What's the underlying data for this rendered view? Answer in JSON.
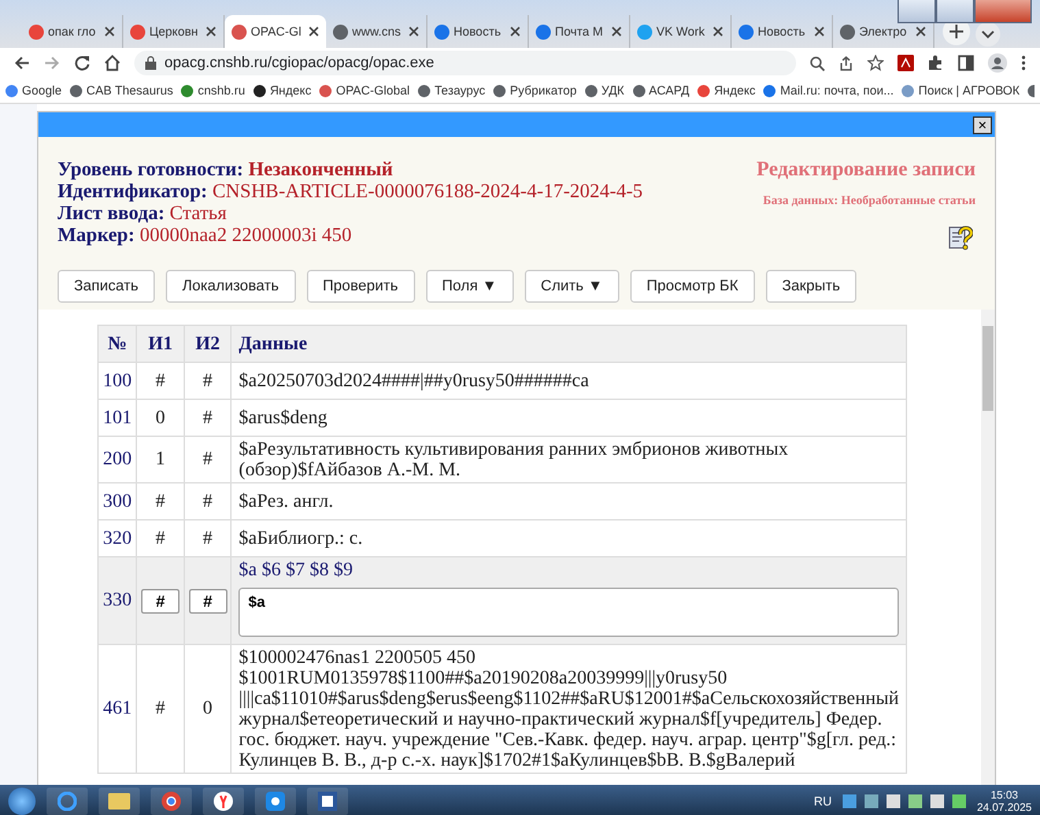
{
  "browser": {
    "tabs": [
      {
        "title": "опак гло",
        "selected": false,
        "color": "#e8453c"
      },
      {
        "title": "Церковн",
        "selected": false,
        "color": "#e8453c"
      },
      {
        "title": "OPAC-Gl",
        "selected": true,
        "color": "#d9534f"
      },
      {
        "title": "www.cns",
        "selected": false,
        "color": "#5f6368"
      },
      {
        "title": "Новость",
        "selected": false,
        "color": "#1a73e8"
      },
      {
        "title": "Почта M",
        "selected": false,
        "color": "#1a73e8"
      },
      {
        "title": "VK Work",
        "selected": false,
        "color": "#1fa2f0"
      },
      {
        "title": "Новость",
        "selected": false,
        "color": "#1a73e8"
      },
      {
        "title": "Электро",
        "selected": false,
        "color": "#5f6368"
      }
    ],
    "url": "opacg.cnshb.ru/cgiopac/opacg/opac.exe",
    "bookmarks": [
      {
        "label": "Google",
        "color": "#4285f4"
      },
      {
        "label": "CAB Thesaurus",
        "color": "#5f6368"
      },
      {
        "label": "cnshb.ru",
        "color": "#2e8b2e"
      },
      {
        "label": "Яндекс",
        "color": "#222222"
      },
      {
        "label": "OPAC-Global",
        "color": "#d9534f"
      },
      {
        "label": "Тезаурус",
        "color": "#5f6368"
      },
      {
        "label": "Рубрикатор",
        "color": "#5f6368"
      },
      {
        "label": "УДК",
        "color": "#5f6368"
      },
      {
        "label": "АСАРД",
        "color": "#5f6368"
      },
      {
        "label": "Яндекс",
        "color": "#e8453c"
      },
      {
        "label": "Mail.ru: почта, пои...",
        "color": "#1a73e8"
      },
      {
        "label": "Поиск | АГРОВОК",
        "color": "#7a9cc6"
      }
    ]
  },
  "dialog": {
    "fields": [
      {
        "label": "Уровень готовности:",
        "value": "Незаконченный",
        "bold": true
      },
      {
        "label": "Идентификатор:",
        "value": "CNSHB-ARTICLE-0000076188-2024-4-17-2024-4-5",
        "bold": false
      },
      {
        "label": "Лист ввода:",
        "value": "Статья",
        "bold": false
      },
      {
        "label": "Маркер:",
        "value": "00000naa2 22000003i 450",
        "bold": false
      }
    ],
    "close_label": "×",
    "title": "Редактирование записи",
    "database": "База данных: Необработанные статьи",
    "buttons": [
      "Записать",
      "Локализовать",
      "Проверить",
      "Поля ▼",
      "Слить ▼",
      "Просмотр БК",
      "Закрыть"
    ],
    "table": {
      "columns": [
        "№",
        "И1",
        "И2",
        "Данные"
      ],
      "rows": [
        {
          "kind": "text",
          "tag": "100",
          "ind1": "#",
          "ind2": "#",
          "data": "$a20250703d2024####|##y0rusy50######ca"
        },
        {
          "kind": "text",
          "tag": "101",
          "ind1": "0",
          "ind2": "#",
          "data": "$arus$deng"
        },
        {
          "kind": "text",
          "tag": "200",
          "ind1": "1",
          "ind2": "#",
          "data": "$aРезультативность культивирования ранних эмбрионов животных (обзор)$fАйбазов А.-М. М."
        },
        {
          "kind": "text",
          "tag": "300",
          "ind1": "#",
          "ind2": "#",
          "data": "$aРез. англ."
        },
        {
          "kind": "text",
          "tag": "320",
          "ind1": "#",
          "ind2": "#",
          "data": "$aБиблиогр.: с."
        },
        {
          "kind": "edit",
          "tag": "330",
          "ind1": "#",
          "ind2": "#",
          "subfields": "$a $6 $7 $8 $9",
          "value": "$a"
        },
        {
          "kind": "text",
          "tag": "461",
          "ind1": "#",
          "ind2": "0",
          "data": "$100002476nas1 2200505 450\n$1001RUM0135978$1100##$a20190208a20039999|||y0rusy50\n||||ca$11010#$arus$deng$erus$eeng$1102##$aRU$12001#$aСельскохозяйственный журнал$eтеоретический и научно-практический журнал$f[учредитель] Федер. гос. бюджет. науч. учреждение \"Сев.-Кавк. федер. науч. аграр. центр\"$g[гл. ред.: Кулинцев В. В., д-р с.-х. наук]$1702#1$aКулинцев$bВ. В.$gВалерий"
        }
      ]
    }
  },
  "taskbar": {
    "language": "RU",
    "time": "15:03",
    "date": "24.07.2025"
  }
}
